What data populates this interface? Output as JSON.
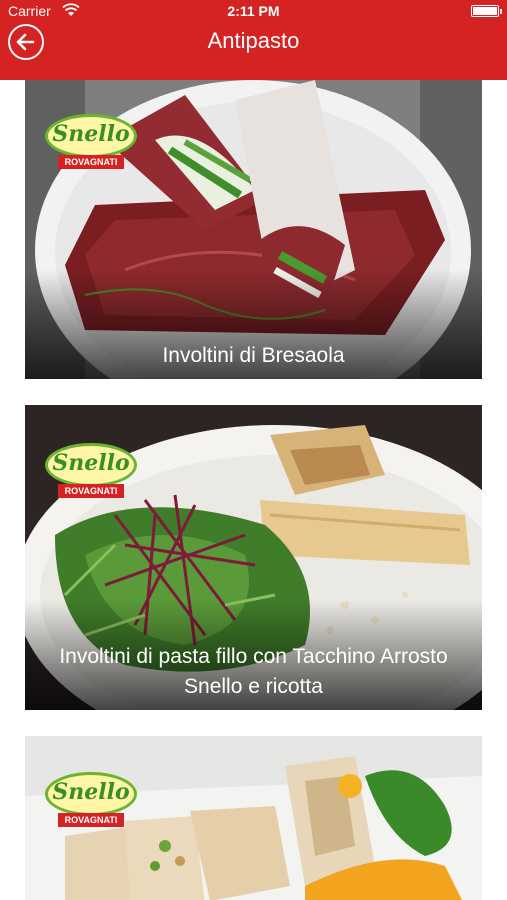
{
  "status_bar": {
    "carrier": "Carrier",
    "time": "2:11 PM"
  },
  "nav_bar": {
    "title": "Antipasto",
    "back_icon": "back-arrow-circle-icon"
  },
  "colors": {
    "brand_red": "#d42322",
    "badge_green": "#3b8f21",
    "badge_fill": "#fff6a8"
  },
  "recipes": [
    {
      "title": "Involtini di Bresaola",
      "badge_brand": "Snello",
      "badge_sub": "ROVAGNATI"
    },
    {
      "title": "Involtini di pasta fillo con Tacchino Arrosto Snello e ricotta",
      "badge_brand": "Snello",
      "badge_sub": "ROVAGNATI"
    },
    {
      "title": "",
      "badge_brand": "Snello",
      "badge_sub": "ROVAGNATI"
    }
  ]
}
